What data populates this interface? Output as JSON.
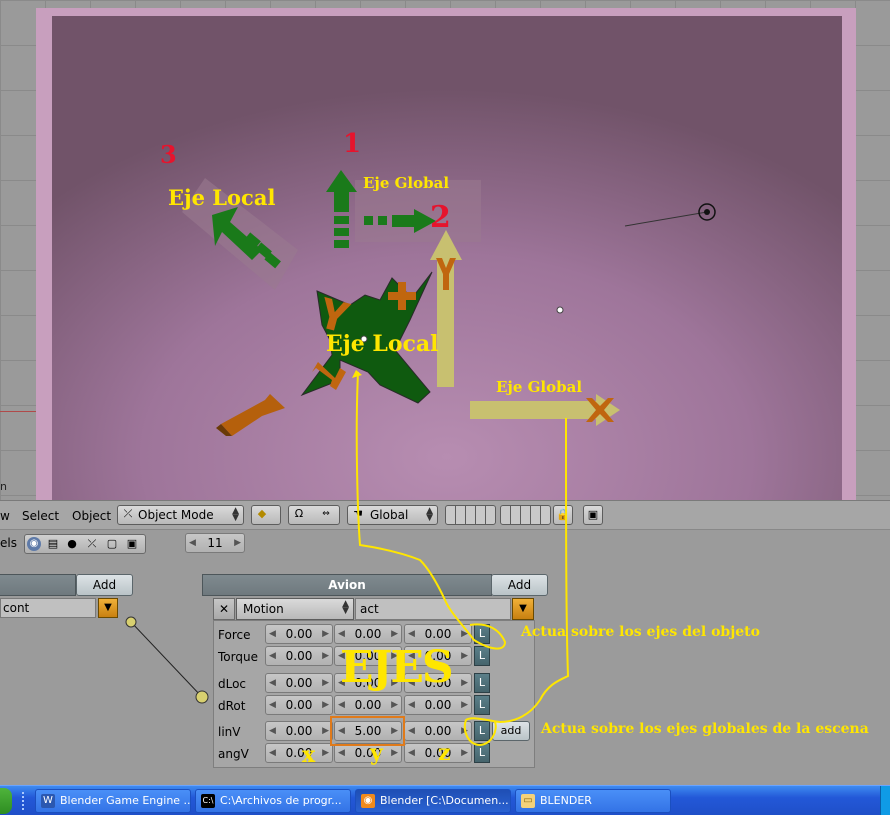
{
  "viewport": {
    "labels": {
      "num_1": "1",
      "num_2": "2",
      "num_3": "3",
      "eje_local_left": "Eje Local",
      "eje_global_top": "Eje Global",
      "eje_local_center": "Eje Local",
      "eje_global_right": "Eje Global",
      "axis_y": "Y",
      "clip_text": "n"
    }
  },
  "header": {
    "menus": [
      "w",
      "Select",
      "Object"
    ],
    "mode_select": "Object Mode",
    "orientation_select": "Global"
  },
  "panel": {
    "left_label_clip": "els",
    "frame_counter": "11",
    "controller": {
      "add_label": "Add",
      "name": "cont"
    },
    "actuator": {
      "object_name": "Avion",
      "add_label": "Add",
      "type": "Motion",
      "name": "act",
      "rows": [
        {
          "label": "Force",
          "values": [
            "0.00",
            "0.00",
            "0.00"
          ],
          "flag": "L"
        },
        {
          "label": "Torque",
          "values": [
            "0.00",
            "0.00",
            "0.00"
          ],
          "flag": "L"
        },
        {
          "label": "dLoc",
          "values": [
            "0.00",
            "0.00",
            "0.00"
          ],
          "flag": "L"
        },
        {
          "label": "dRot",
          "values": [
            "0.00",
            "0.00",
            "0.00"
          ],
          "flag": "L"
        },
        {
          "label": "linV",
          "values": [
            "0.00",
            "5.00",
            "0.00"
          ],
          "flag": "L"
        },
        {
          "label": "angV",
          "values": [
            "0.00",
            "0.00",
            "0.00"
          ],
          "flag": "L"
        }
      ],
      "add_toggle": "add"
    }
  },
  "annotations": {
    "ejes": "EJES",
    "note_object": "Actua sobre los ejes del objeto",
    "note_global": "Actua sobre los ejes globales de la escena",
    "x": "x",
    "y": "y",
    "z": "z"
  },
  "taskbar": {
    "items": [
      {
        "label": "Blender Game Engine ...",
        "icon": "word-icon"
      },
      {
        "label": "C:\\Archivos de progr...",
        "icon": "console-icon"
      },
      {
        "label": "Blender [C:\\Documen...",
        "icon": "blender-icon"
      },
      {
        "label": "BLENDER",
        "icon": "folder-icon"
      }
    ]
  },
  "colors": {
    "annotation_yellow": "#ffe600",
    "number_red": "#e6142d",
    "arrow_green": "#1a7a1a",
    "arrow_orange": "#c0660f",
    "viewport_purple": "#9e759a"
  }
}
